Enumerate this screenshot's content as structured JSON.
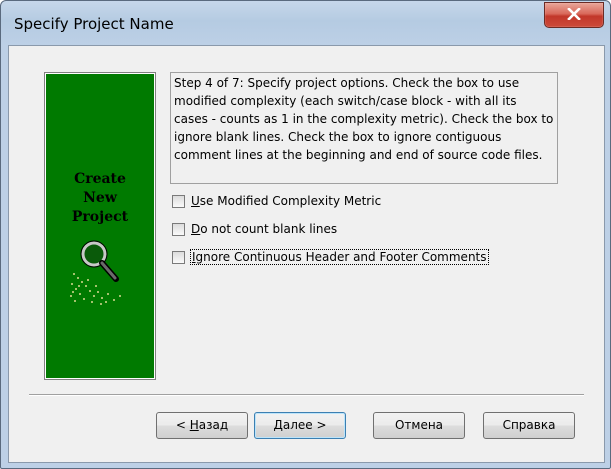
{
  "window": {
    "title": "Specify Project Name"
  },
  "side_panel": {
    "line1": "Create",
    "line2": "New",
    "line3": "Project",
    "icon": "magnifier-icon",
    "background": "#007a00"
  },
  "description": "Step 4 of 7: Specify project options. Check the box to use modified complexity (each switch/case block - with all its cases - counts as 1 in the complexity metric). Check the box to ignore blank lines. Check the box to ignore contiguous comment lines at the beginning and end of source code files.",
  "options": [
    {
      "mnemonic": "U",
      "rest": "se Modified Complexity Metric",
      "checked": false
    },
    {
      "mnemonic": "D",
      "rest": "o not count blank lines",
      "checked": false
    },
    {
      "mnemonic": "I",
      "rest": "gnore Continuous Header and Footer Comments",
      "checked": false
    }
  ],
  "buttons": {
    "back": {
      "prefix": "< ",
      "mnemonic": "Н",
      "rest": "азад"
    },
    "next": {
      "mnemonic": "Д",
      "rest": "алее >"
    },
    "cancel": "Отмена",
    "help": "Справка"
  }
}
